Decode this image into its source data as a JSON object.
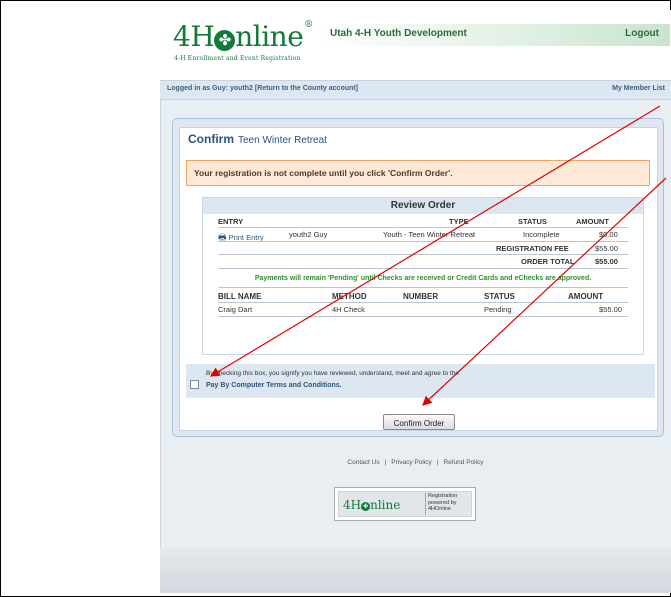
{
  "header": {
    "logo_main": "4H",
    "logo_tail": "nline",
    "logo_mark": "®",
    "logo_sub": "4-H Enrollment and Event Registration",
    "org_title": "Utah 4-H Youth Development",
    "logout_label": "Logout"
  },
  "userbar": {
    "logged_in_text": "Logged in as Guy: youth2 [Return to the County account]",
    "member_list_link": "My Member List"
  },
  "confirm": {
    "title": "Confirm",
    "event_name": "Teen Winter Retreat",
    "warning": "Your registration is not complete until you click 'Confirm Order'."
  },
  "review": {
    "heading": "Review Order",
    "columns": [
      "ENTRY",
      "TYPE",
      "STATUS",
      "AMOUNT"
    ],
    "entry": {
      "print_label": "Print Entry",
      "member": "youth2 Guy",
      "type": "Youth - Teen Winter Retreat",
      "status": "Incomplete",
      "amount": "$0.00"
    },
    "fee_label": "REGISTRATION FEE",
    "fee_amount": "$55.00",
    "total_label": "ORDER TOTAL",
    "total_amount": "$55.00",
    "payment_note": "Payments will remain 'Pending' until Checks are received or Credit Cards and eChecks are approved.",
    "bill_columns": [
      "BILL NAME",
      "METHOD",
      "NUMBER",
      "STATUS",
      "AMOUNT"
    ],
    "bill": {
      "name": "Craig Dart",
      "method": "4H Check",
      "number": "",
      "status": "Pending",
      "amount": "$55.00"
    }
  },
  "terms": {
    "text": "By checking this box, you signify you have reviewed, understand, meet and agree to the",
    "link": "Pay By Computer Terms and Conditions.",
    "checked": false
  },
  "confirm_button": "Confirm Order",
  "footer": {
    "links": [
      "Contact Us",
      "Privacy Policy",
      "Refund Policy"
    ],
    "separator": "|",
    "badge_text_1": "Registration",
    "badge_text_2": "powered by",
    "badge_text_3": "4HOnline"
  },
  "colors": {
    "brand_green": "#137a3a",
    "link_blue": "#2b547c",
    "warning_border": "#f0a565",
    "annotation_red": "#e00000"
  }
}
